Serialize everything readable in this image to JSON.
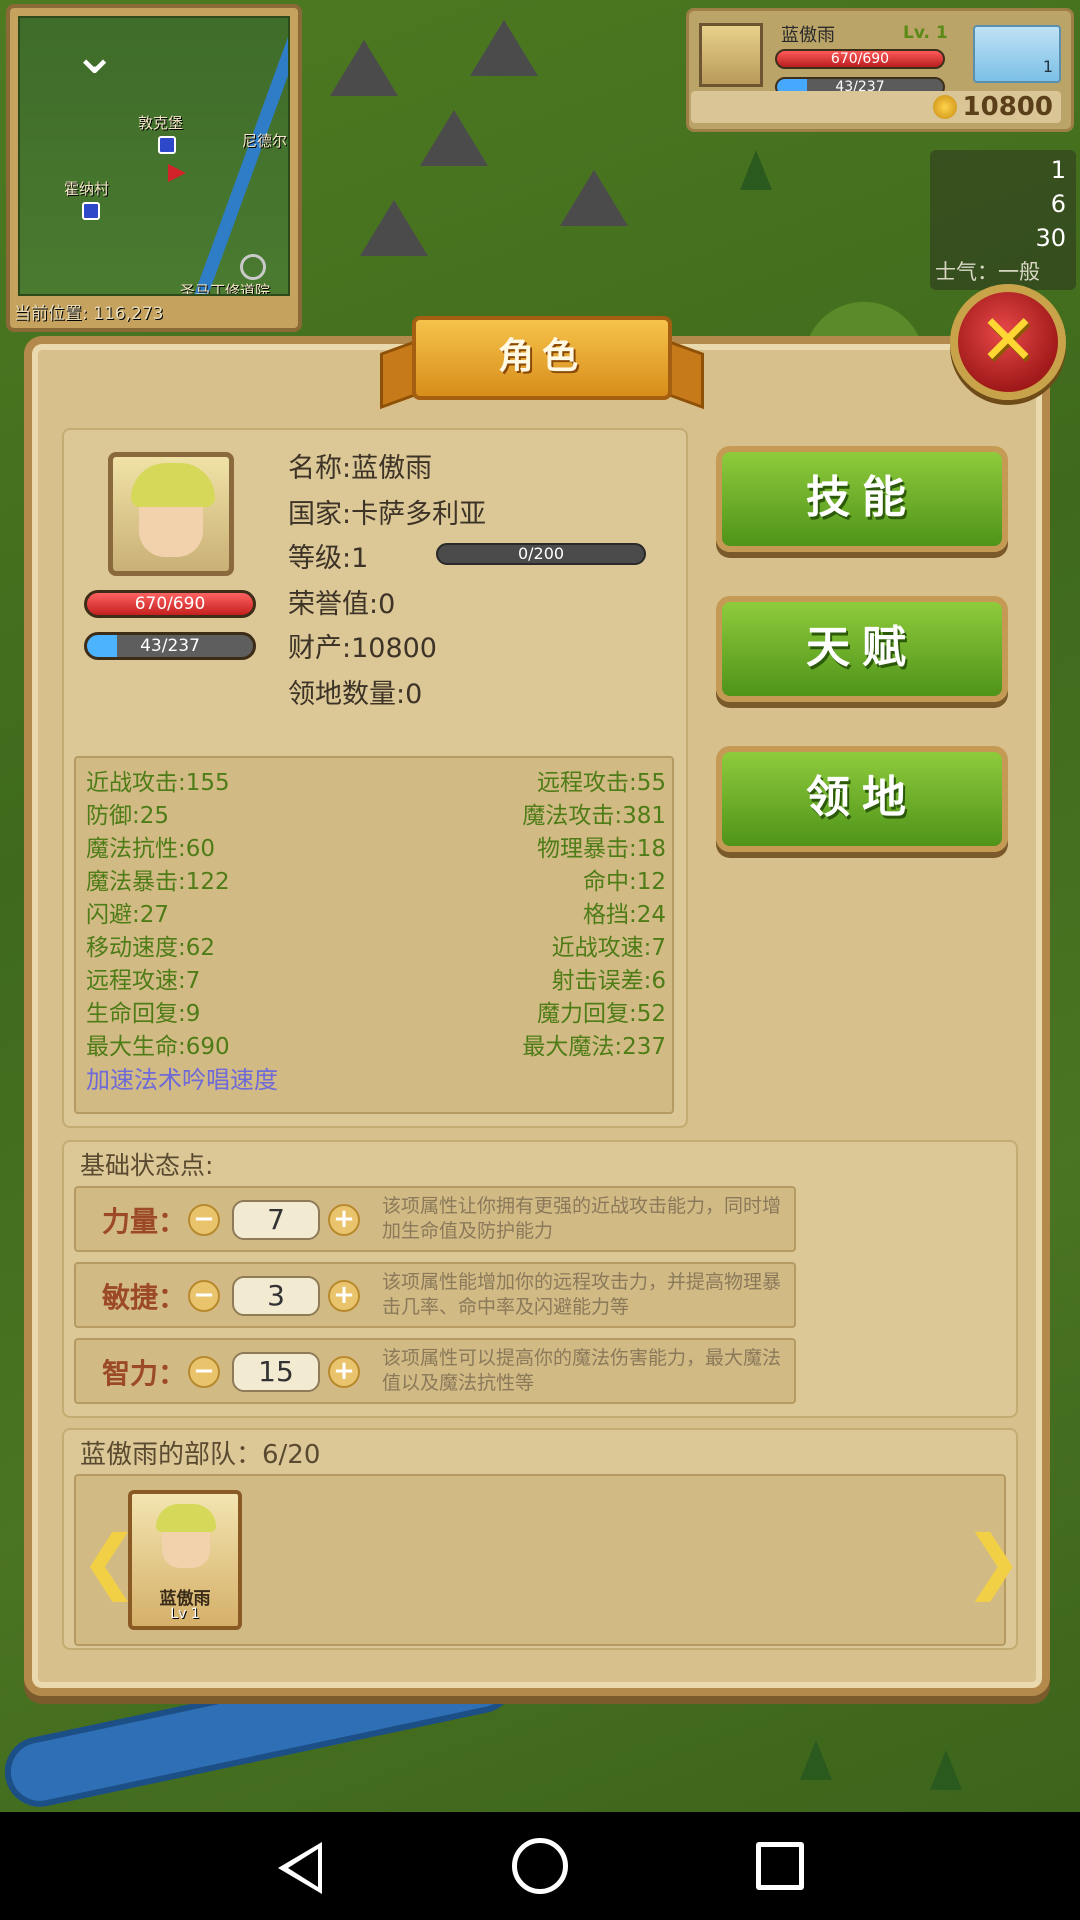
{
  "minimap": {
    "labels": [
      "敦克堡",
      "尼德尔",
      "霍纳村",
      "圣马丁修道院"
    ],
    "position": "当前位置: 116,273"
  },
  "hud": {
    "name": "蓝傲雨",
    "level": "Lv. 1",
    "hp": "670/690",
    "mp": "43/237",
    "weather_time": "1",
    "gold": "10800"
  },
  "army": {
    "counts": [
      "1",
      "6",
      "30"
    ],
    "morale": "士气：一般"
  },
  "dialog": {
    "title": "角色",
    "close_icon": "✕",
    "hp_bar": "670/690",
    "mp_bar": "43/237",
    "info": {
      "name": "名称:蓝傲雨",
      "country": "国家:卡萨多利亚",
      "level": "等级:1",
      "exp": "0/200",
      "honor": "荣誉值:0",
      "wealth": "财产:10800",
      "territory": "领地数量:0"
    },
    "stats_left": [
      "近战攻击:155",
      "防御:25",
      "魔法抗性:60",
      "魔法暴击:122",
      "闪避:27",
      "移动速度:62",
      "远程攻速:7",
      "生命回复:9",
      "最大生命:690"
    ],
    "stats_right": [
      "远程攻击:55",
      "魔法攻击:381",
      "物理暴击:18",
      "命中:12",
      "格挡:24",
      "近战攻速:7",
      "射击误差:6",
      "魔力回复:52",
      "最大魔法:237"
    ],
    "stat_link": "加速法术吟唱速度",
    "buttons": [
      "技能",
      "天赋",
      "领地"
    ],
    "attributes_title": "基础状态点:",
    "attributes": [
      {
        "label": "力量：",
        "value": "7",
        "desc": "该项属性让你拥有更强的近战攻击能力，同时增加生命值及防护能力"
      },
      {
        "label": "敏捷：",
        "value": "3",
        "desc": "该项属性能增加你的远程攻击力，并提高物理暴击几率、命中率及闪避能力等"
      },
      {
        "label": "智力：",
        "value": "15",
        "desc": "该项属性可以提高你的魔法伤害能力，最大魔法值以及魔法抗性等"
      }
    ],
    "minus": "−",
    "plus": "+",
    "troops_title": "蓝傲雨的部队：6/20",
    "troop_card": {
      "name": "蓝傲雨",
      "level": "Lv 1"
    },
    "arrow_left": "❮",
    "arrow_right": "❯"
  },
  "navbar": {
    "down": "⌄"
  }
}
